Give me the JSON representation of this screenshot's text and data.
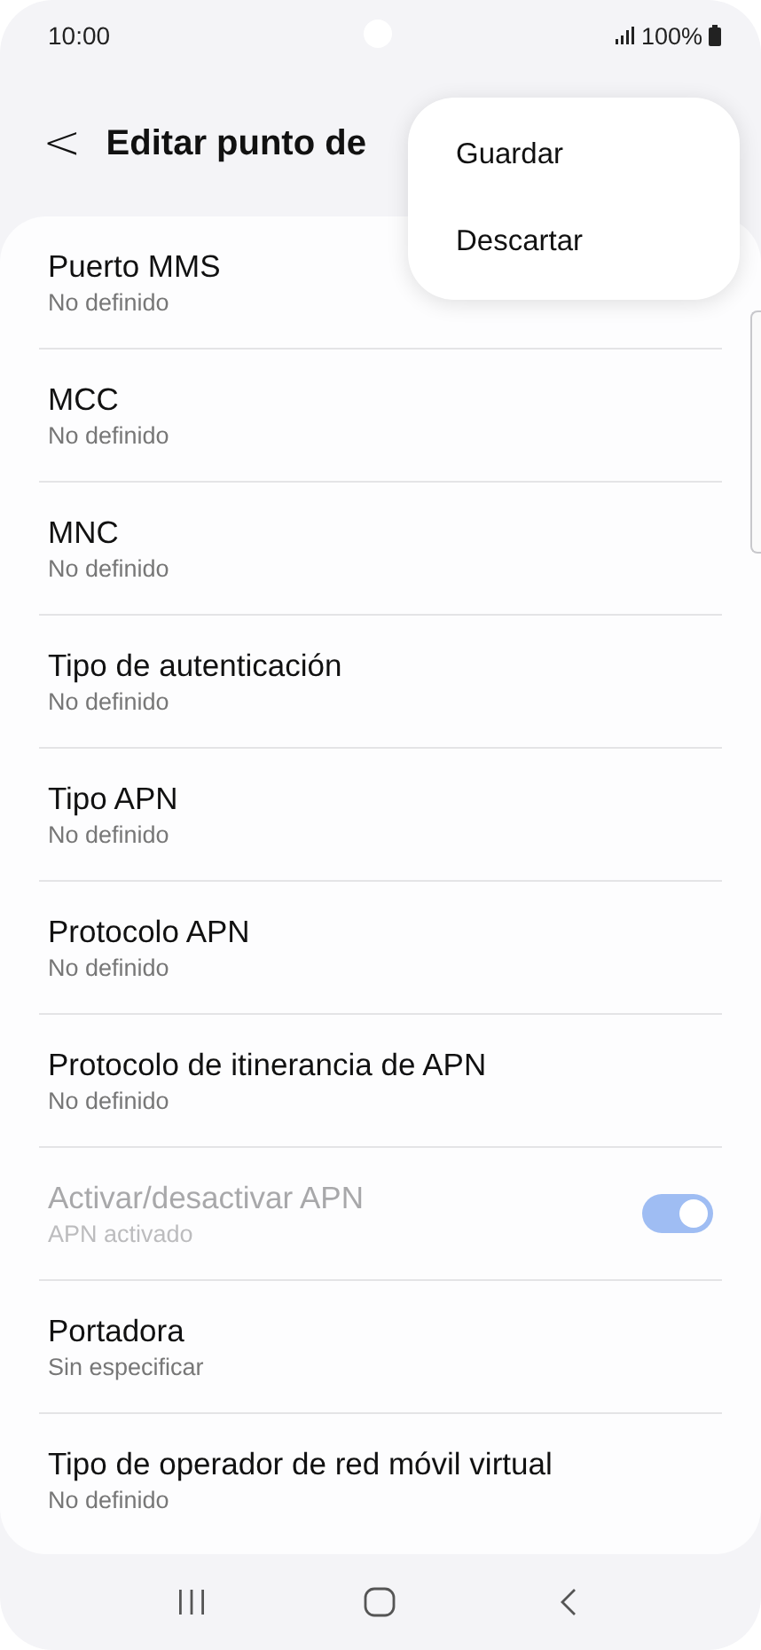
{
  "status_bar": {
    "time": "10:00",
    "battery": "100%"
  },
  "header": {
    "back_icon": "<",
    "title": "Editar punto de"
  },
  "menu": {
    "items": [
      {
        "label": "Guardar"
      },
      {
        "label": "Descartar"
      }
    ]
  },
  "settings": [
    {
      "kind": "text",
      "title": "Puerto MMS",
      "value": "No definido",
      "disabled": false
    },
    {
      "kind": "text",
      "title": "MCC",
      "value": "No definido",
      "disabled": false
    },
    {
      "kind": "text",
      "title": "MNC",
      "value": "No definido",
      "disabled": false
    },
    {
      "kind": "text",
      "title": "Tipo de autenticación",
      "value": "No definido",
      "disabled": false
    },
    {
      "kind": "text",
      "title": "Tipo APN",
      "value": "No definido",
      "disabled": false
    },
    {
      "kind": "text",
      "title": "Protocolo APN",
      "value": "No definido",
      "disabled": false
    },
    {
      "kind": "text",
      "title": "Protocolo de itinerancia de APN",
      "value": "No definido",
      "disabled": false
    },
    {
      "kind": "toggle",
      "title": "Activar/desactivar APN",
      "value": "APN activado",
      "disabled": true,
      "on": true
    },
    {
      "kind": "text",
      "title": "Portadora",
      "value": "Sin especificar",
      "disabled": false
    },
    {
      "kind": "text",
      "title": "Tipo de operador de red móvil virtual",
      "value": "No definido",
      "disabled": false
    }
  ]
}
